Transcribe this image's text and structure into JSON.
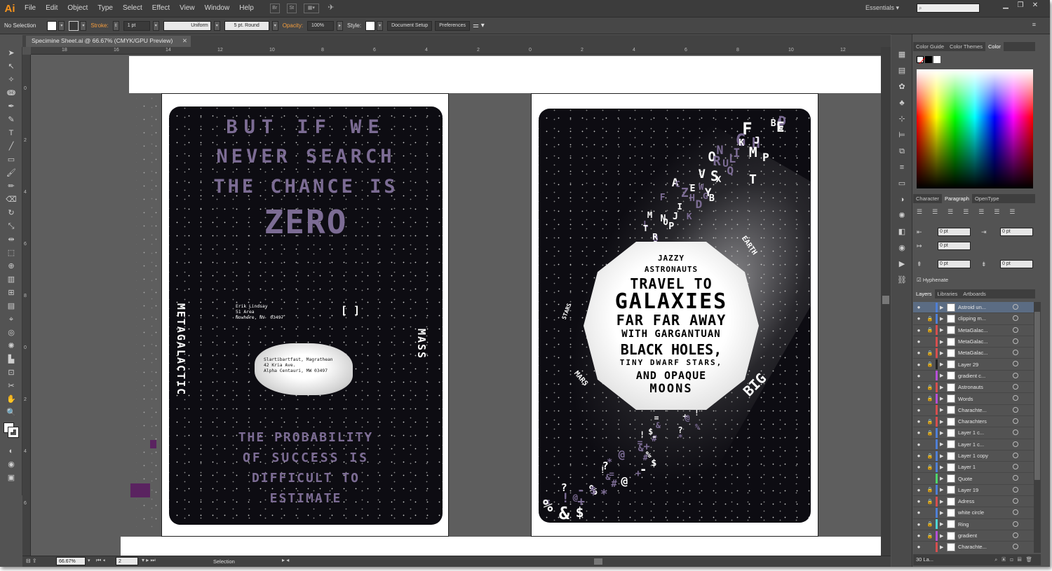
{
  "app": {
    "logo": "Ai",
    "menu": [
      "File",
      "Edit",
      "Object",
      "Type",
      "Select",
      "Effect",
      "View",
      "Window",
      "Help"
    ],
    "workspace": "Essentials",
    "search_placeholder": ""
  },
  "control": {
    "selection": "No Selection",
    "stroke_label": "Stroke:",
    "stroke_weight": "1 pt",
    "profile": "Uniform",
    "brush": "5 pt. Round",
    "opacity_label": "Opacity:",
    "opacity": "100%",
    "style_label": "Style:",
    "doc_setup": "Document Setup",
    "preferences": "Preferences"
  },
  "document": {
    "tab_title": "Specimine Sheet.ai @ 66.67% (CMYK/GPU Preview)",
    "zoom": "66.67%",
    "artboard_num": "2",
    "status_tool": "Selection",
    "ruler_h": [
      "18",
      "16",
      "14",
      "12",
      "10",
      "8",
      "6",
      "4",
      "2",
      "0",
      "2",
      "4",
      "6",
      "8",
      "10",
      "12",
      "14"
    ],
    "ruler_v": [
      "0",
      "2",
      "4",
      "6",
      "8",
      "0",
      "2",
      "4",
      "6"
    ]
  },
  "poster1": {
    "line1": "BUT IF WE",
    "line2": "NEVER SEARCH",
    "line3": "THE CHANCE IS",
    "zero": "ZERO",
    "left_vertical": "METAGALACTIC",
    "right_vertical": "MASS",
    "brackets": "[ ]",
    "addr1": "Erik Lindsay\n51 Area\nNowhere, NV  03497",
    "addr2": "Slartibartfast, Magrathean\n42 Kria Ave.\nAlpha Centauri, MW 03497",
    "bottom1": "THE PROBABILITY",
    "bottom2": "OF SUCCESS IS",
    "bottom3": "DIFFICULT TO",
    "bottom4": "ESTIMATE"
  },
  "poster2": {
    "l1": "JAZZY",
    "l2": "ASTRONAUTS",
    "l3": "TRAVEL TO",
    "l4": "GALAXIES",
    "l5": "FAR FAR AWAY",
    "l6": "WITH GARGANTUAN",
    "l7": "BLACK HOLES,",
    "l8": "TINY DWARF STARS,",
    "l9": "AND OPAQUE",
    "l10": "MOONS",
    "earth": "EARTH",
    "stars": "STARS",
    "mars": "MARS",
    "big": "BIG",
    "letters": "ABCDEFGHIJKLMNOPQRSTUVWXYZ",
    "symbols": "!+=@&%$#?*-"
  },
  "panels": {
    "color_tabs": [
      "Color Guide",
      "Color Themes",
      "Color"
    ],
    "para_tabs": [
      "Character",
      "Paragraph",
      "OpenType"
    ],
    "indent_values": [
      "0 pt",
      "0 pt",
      "0 pt",
      "0 pt",
      "0 pt"
    ],
    "hyphenate": "Hyphenate",
    "layer_tabs": [
      "Layers",
      "Libraries",
      "Artboards"
    ],
    "layer_count": "30 La...",
    "layers": [
      {
        "name": "Astroid un...",
        "color": "#4f7fd6"
      },
      {
        "name": "clipping m...",
        "color": "#4f7fd6"
      },
      {
        "name": "MetaGalac...",
        "color": "#d64f4f"
      },
      {
        "name": "MetaGalac...",
        "color": "#d64f4f"
      },
      {
        "name": "MetaGalac...",
        "color": "#d64f4f"
      },
      {
        "name": "Layer 29",
        "color": "#222222"
      },
      {
        "name": "gradient c...",
        "color": "#b64fd6"
      },
      {
        "name": "Astronauts",
        "color": "#d64f4f"
      },
      {
        "name": "Words",
        "color": "#b64fd6"
      },
      {
        "name": "Charachte...",
        "color": "#d64f4f"
      },
      {
        "name": "Charachters",
        "color": "#d64f4f"
      },
      {
        "name": "Layer 1 c...",
        "color": "#4f7fd6"
      },
      {
        "name": "Layer 1 c...",
        "color": "#4f7fd6"
      },
      {
        "name": "Layer 1 copy",
        "color": "#4f7fd6"
      },
      {
        "name": "Layer 1",
        "color": "#4f7fd6"
      },
      {
        "name": "Quote",
        "color": "#4fd66a"
      },
      {
        "name": "Layer 19",
        "color": "#4f7fd6"
      },
      {
        "name": "Adress",
        "color": "#d64f4f"
      },
      {
        "name": "white circle",
        "color": "#4f7fd6"
      },
      {
        "name": "Ring",
        "color": "#4fd6d6"
      },
      {
        "name": "gradient",
        "color": "#b64fd6"
      },
      {
        "name": "Charachte...",
        "color": "#d64f4f"
      }
    ]
  },
  "colors": {
    "accent_orange": "#f39c3d",
    "poster_purple": "#7c6c94",
    "bg_dark": "#535353"
  }
}
